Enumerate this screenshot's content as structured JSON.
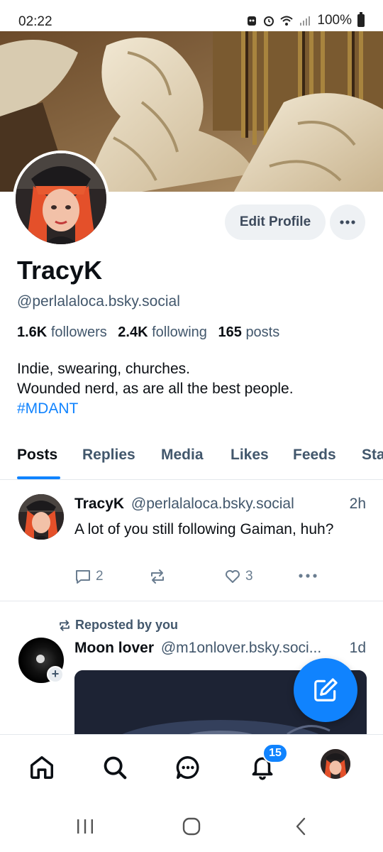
{
  "status_bar": {
    "time": "02:22",
    "battery": "100%"
  },
  "profile": {
    "display_name": "TracyK",
    "handle": "@perlalaloca.bsky.social",
    "edit_label": "Edit Profile",
    "followers_count": "1.6K",
    "followers_label": "followers",
    "following_count": "2.4K",
    "following_label": "following",
    "posts_count": "165",
    "posts_label": "posts",
    "bio_line1": "Indie, swearing, churches.",
    "bio_line2": "Wounded nerd, as are all the best people.",
    "bio_hashtag": "#MDANT"
  },
  "tabs": [
    "Posts",
    "Replies",
    "Media",
    "Likes",
    "Feeds",
    "Sta"
  ],
  "active_tab": "Posts",
  "post": {
    "author_name": "TracyK",
    "author_handle": "@perlalaloca.bsky.social",
    "time": "2h",
    "text": "A lot of you still following Gaiman, huh?",
    "reply_count": "2",
    "like_count": "3"
  },
  "repost": {
    "label": "Reposted by you",
    "author_name": "Moon lover",
    "author_handle": "@m1onlover.bsky.soci...",
    "time": "1d"
  },
  "bottom_nav": {
    "notification_badge": "15"
  },
  "colors": {
    "accent": "#1083fe",
    "text_primary": "#0b0f14",
    "text_secondary": "#42576c",
    "button_bg": "#eef1f4"
  },
  "icons": [
    "home-icon",
    "search-icon",
    "chat-icon",
    "bell-icon",
    "compose-icon",
    "reply-icon",
    "repost-icon",
    "like-icon",
    "more-icon"
  ]
}
